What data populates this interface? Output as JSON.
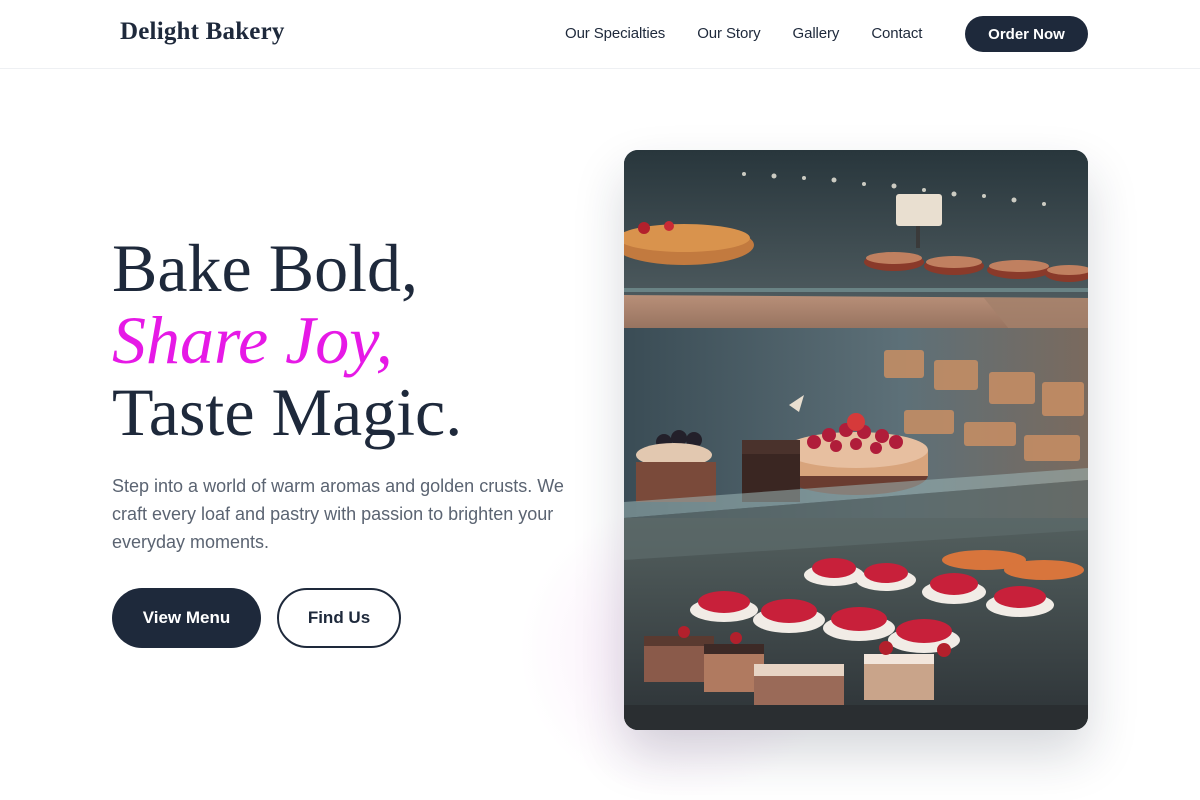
{
  "brand": {
    "name": "Delight Bakery"
  },
  "nav": {
    "links": [
      "Our Specialties",
      "Our Story",
      "Gallery",
      "Contact"
    ],
    "cta": "Order Now"
  },
  "hero": {
    "headline": {
      "line1": "Bake Bold,",
      "line2": "Share Joy,",
      "line3": "Taste Magic."
    },
    "description": "Step into a world of warm aromas and golden crusts. We craft every loaf and pastry with passion to brighten your everyday moments.",
    "primary_button": "View Menu",
    "secondary_button": "Find Us",
    "image": "bakery-display-case-photo"
  },
  "colors": {
    "primary": "#1e293b",
    "accent": "#e619e6",
    "body_text": "#5b6472"
  }
}
